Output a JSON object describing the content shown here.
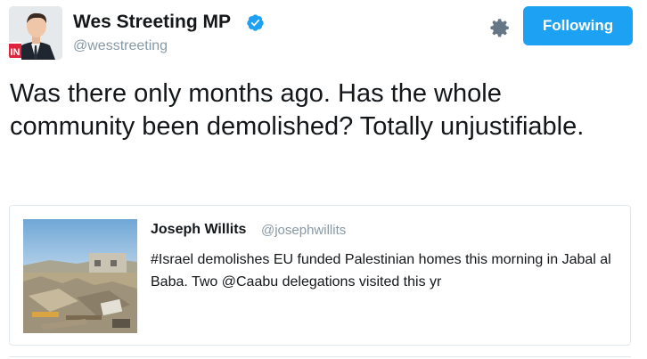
{
  "author": {
    "display_name": "Wes Streeting MP",
    "handle": "@wesstreeting",
    "avatar_badge": "IN",
    "verified": true
  },
  "actions": {
    "settings_icon": "gear-icon",
    "follow_label": "Following"
  },
  "tweet": {
    "text": "Was there only months ago. Has the whole community been demolished? Totally unjustifiable."
  },
  "quote": {
    "display_name": "Joseph Willits",
    "handle": "@josephwillits",
    "text": "#Israel demolishes EU funded Palestinian homes this morning in Jabal al Baba. Two @Caabu delegations visited this yr"
  },
  "colors": {
    "accent": "#1da1f2",
    "text": "#14171a",
    "muted": "#8899a6",
    "border": "#e1e8ed"
  }
}
